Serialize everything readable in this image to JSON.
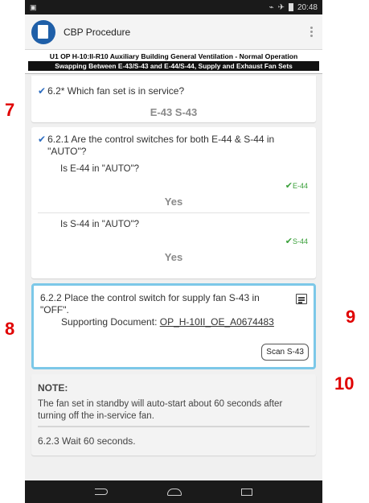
{
  "status_bar": {
    "time": "20:48"
  },
  "app": {
    "title": "CBP Procedure"
  },
  "procedure": {
    "title": "U1 OP H-10:II-R10 Auxiliary Building General Ventilation - Normal Operation",
    "subtitle": "Swapping Between E-43/S-43 and E-44/S-44, Supply and Exhaust Fan Sets"
  },
  "steps": {
    "s62": {
      "question": "6.2* Which fan set is in service?",
      "answer": "E-43 S-43"
    },
    "s621": {
      "question": "6.2.1 Are the control switches for both E-44 & S-44 in \"AUTO\"?",
      "sub": [
        {
          "question": "Is E-44 in \"AUTO\"?",
          "tag": "E-44",
          "answer": "Yes"
        },
        {
          "question": "Is S-44 in \"AUTO\"?",
          "tag": "S-44",
          "answer": "Yes"
        }
      ]
    },
    "s622": {
      "question": "6.2.2 Place the control switch for supply fan S-43 in \"OFF\".",
      "doc_label": "Supporting Document: ",
      "doc_link": "OP_H-10II_OE_A0674483",
      "scan_label": "Scan S-43"
    },
    "note": {
      "header": "NOTE:",
      "body": "The fan set in standby will auto-start about 60 seconds after turning off the in-service fan."
    },
    "s623": {
      "text": "6.2.3 Wait 60 seconds."
    }
  },
  "callouts": {
    "c7": "7",
    "c8": "8",
    "c9": "9",
    "c10": "10"
  },
  "colors": {
    "accent_blue": "#2d6cc0",
    "selected_border": "#7cc8e8",
    "confirm_green": "#3aa03a",
    "callout_red": "#e00000"
  }
}
